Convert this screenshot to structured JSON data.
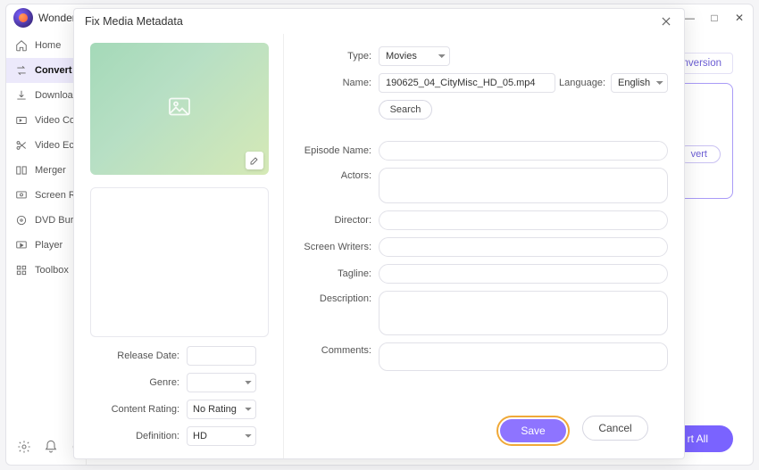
{
  "app": {
    "title": "Wonder"
  },
  "window_controls": {
    "min": "—",
    "max": "□",
    "close": "✕"
  },
  "sidebar": {
    "items": [
      {
        "label": "Home"
      },
      {
        "label": "Convert"
      },
      {
        "label": "Downloa"
      },
      {
        "label": "Video Co"
      },
      {
        "label": "Video Ec"
      },
      {
        "label": "Merger"
      },
      {
        "label": "Screen R"
      },
      {
        "label": "DVD Bur"
      },
      {
        "label": "Player"
      },
      {
        "label": "Toolbox"
      }
    ]
  },
  "main": {
    "conversion_pill": "Conversion",
    "preview_btn": "vert",
    "start_all": "rt All"
  },
  "modal": {
    "title": "Fix Media Metadata",
    "type_label": "Type:",
    "type_value": "Movies",
    "name_label": "Name:",
    "name_value": "190625_04_CityMisc_HD_05.mp4",
    "language_label": "Language:",
    "language_value": "English",
    "search_btn": "Search",
    "episode_label": "Episode Name:",
    "actors_label": "Actors:",
    "director_label": "Director:",
    "writers_label": "Screen Writers:",
    "tagline_label": "Tagline:",
    "description_label": "Description:",
    "comments_label": "Comments:",
    "release_label": "Release Date:",
    "genre_label": "Genre:",
    "rating_label": "Content Rating:",
    "rating_value": "No Rating",
    "definition_label": "Definition:",
    "definition_value": "HD",
    "save_btn": "Save",
    "cancel_btn": "Cancel"
  }
}
